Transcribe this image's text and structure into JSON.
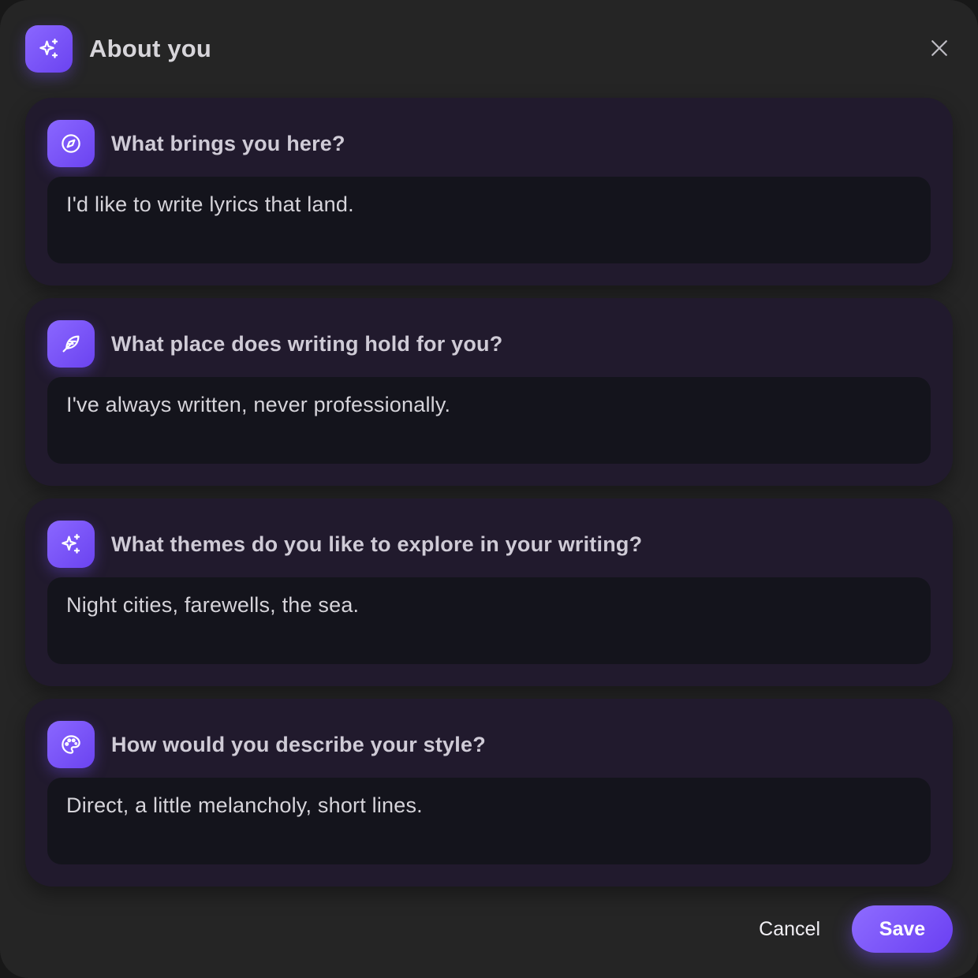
{
  "header": {
    "title": "About you",
    "icon": "sparkles-icon",
    "close_icon": "close-icon"
  },
  "questions": [
    {
      "icon": "compass-icon",
      "label": "What brings you here?",
      "answer": "I'd like to write lyrics that land."
    },
    {
      "icon": "feather-icon",
      "label": "What place does writing hold for you?",
      "answer": "I've always written, never professionally."
    },
    {
      "icon": "sparkles-icon",
      "label": "What themes do you like to explore in your writing?",
      "answer": "Night cities, farewells, the sea."
    },
    {
      "icon": "palette-icon",
      "label": "How would you describe your style?",
      "answer": "Direct, a little melancholy, short lines."
    }
  ],
  "footer": {
    "cancel_label": "Cancel",
    "save_label": "Save"
  },
  "colors": {
    "accent": "#7a55fa",
    "dialog_bg": "#252525",
    "card_bg": "#211a2d",
    "input_bg": "#14141c"
  }
}
